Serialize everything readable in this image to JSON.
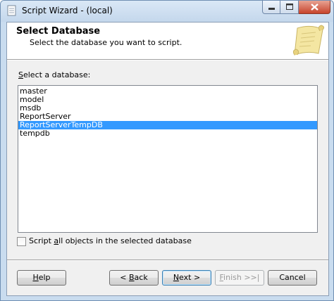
{
  "window": {
    "title": "Script Wizard - (local)",
    "controls": {
      "minimize_icon": "minimize-icon",
      "maximize_icon": "maximize-icon",
      "close_icon": "close-icon"
    }
  },
  "header": {
    "title": "Select Database",
    "subtitle": "Select the database you want to script.",
    "icon": "scroll-icon"
  },
  "body": {
    "select_label": "Select a database:",
    "databases": [
      "master",
      "model",
      "msdb",
      "ReportServer",
      "ReportServerTempDB",
      "tempdb"
    ],
    "selected_database": "ReportServerTempDB",
    "script_all_label": "Script all objects in the selected database",
    "script_all_checked": false
  },
  "buttons": {
    "help": "Help",
    "back": "< Back",
    "next": "Next >",
    "finish": "Finish >>|",
    "cancel": "Cancel"
  },
  "colors": {
    "selection": "#3399ff",
    "title_bar": "#c9dcef",
    "close_button": "#c7442c"
  }
}
